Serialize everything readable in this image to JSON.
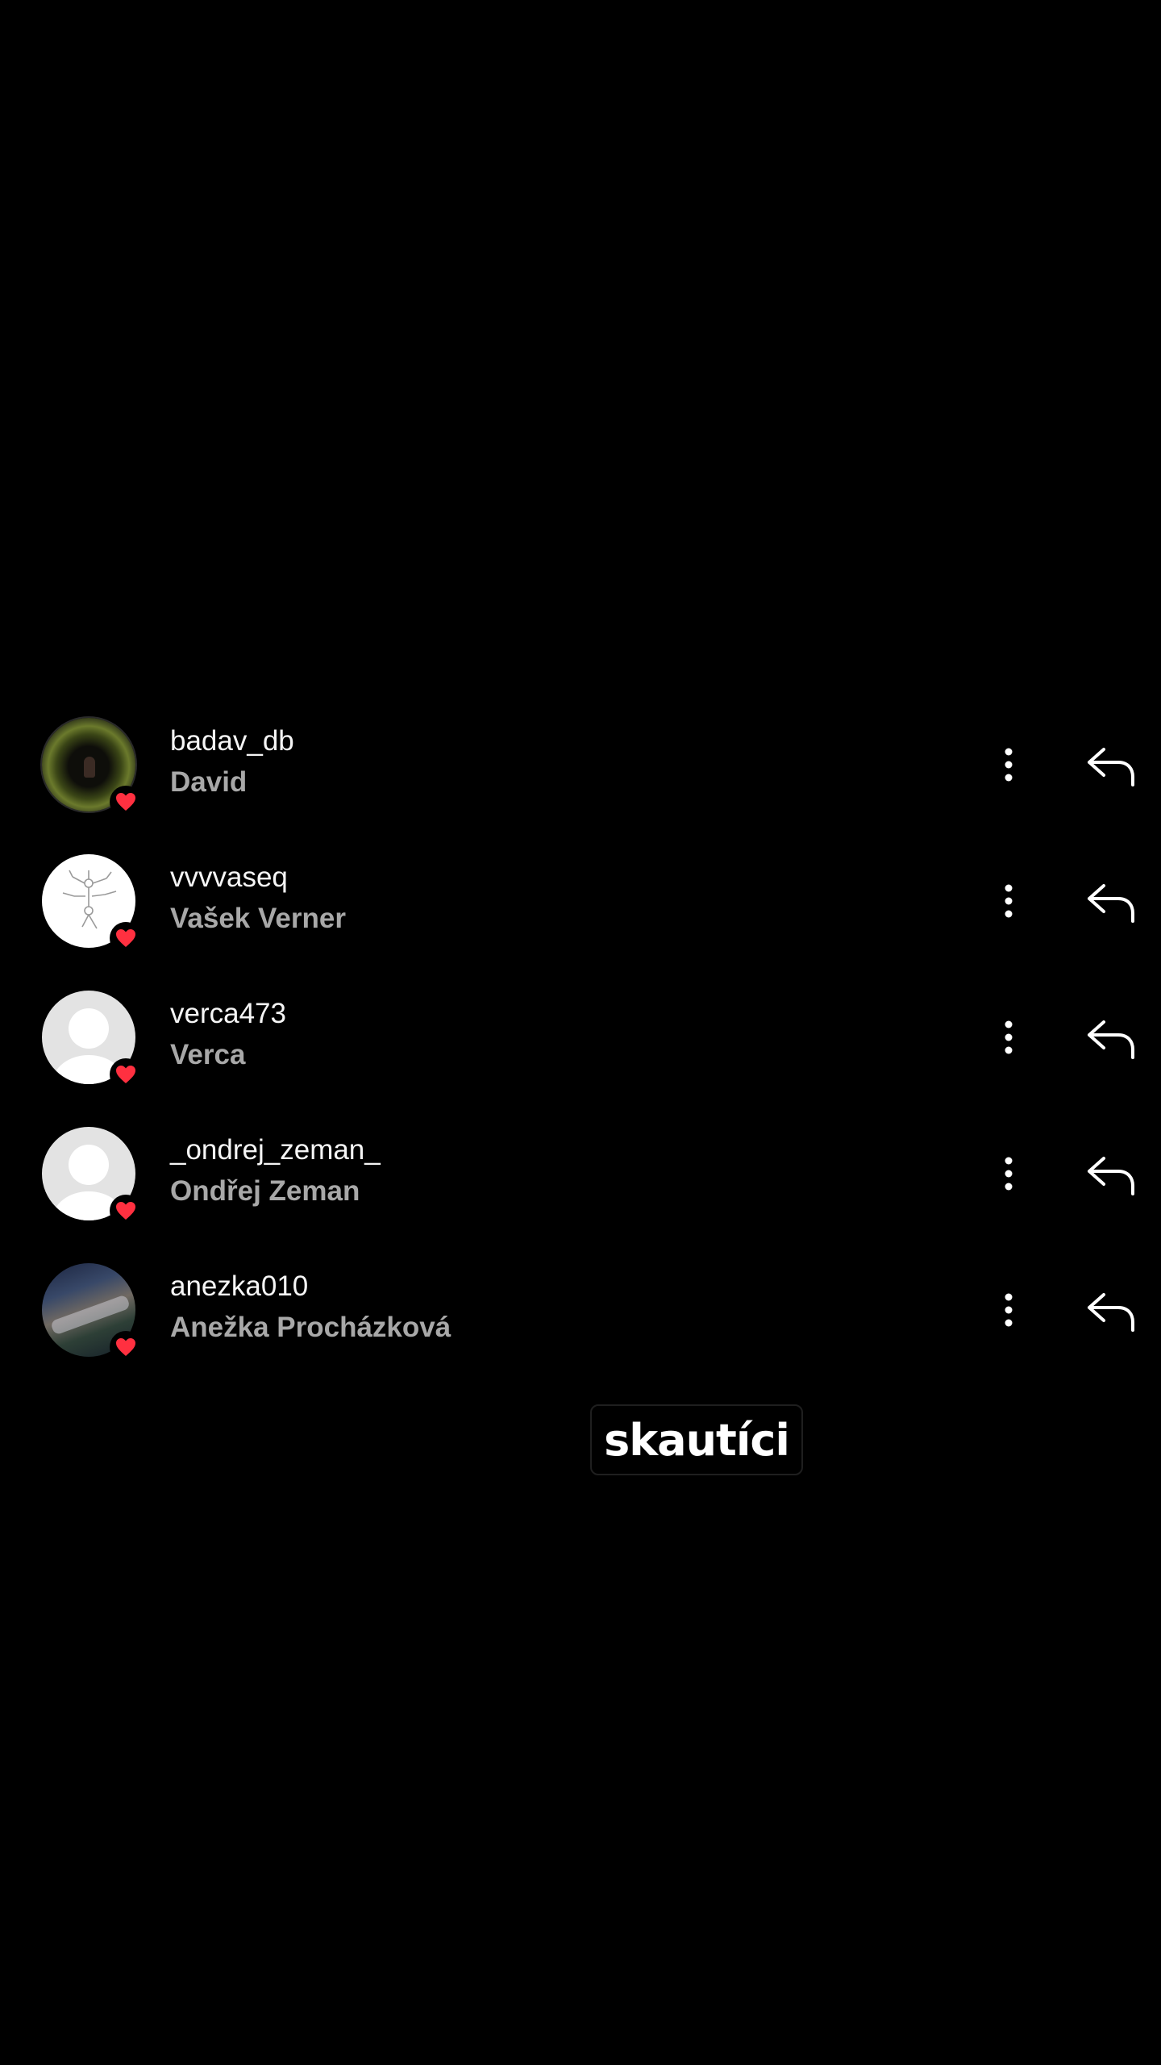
{
  "likes": [
    {
      "username": "badav_db",
      "full_name": "David",
      "avatar": "dark-photo-avatar"
    },
    {
      "username": "vvvvaseq",
      "full_name": "Vašek Verner",
      "avatar": "drawing-avatar"
    },
    {
      "username": "verca473",
      "full_name": "Verca",
      "avatar": "default-avatar"
    },
    {
      "username": "_ondrej_zeman_",
      "full_name": "Ondřej Zeman",
      "avatar": "default-avatar"
    },
    {
      "username": "anezka010",
      "full_name": "Anežka Procházková",
      "avatar": "photo-avatar"
    }
  ],
  "icons": {
    "badge": "heart-icon",
    "more": "more-vertical-icon",
    "reply": "reply-arrow-icon"
  },
  "colors": {
    "background": "#000000",
    "heart": "#ff3040",
    "secondary_text": "#a8a8a8"
  },
  "story_text": "skautíci"
}
